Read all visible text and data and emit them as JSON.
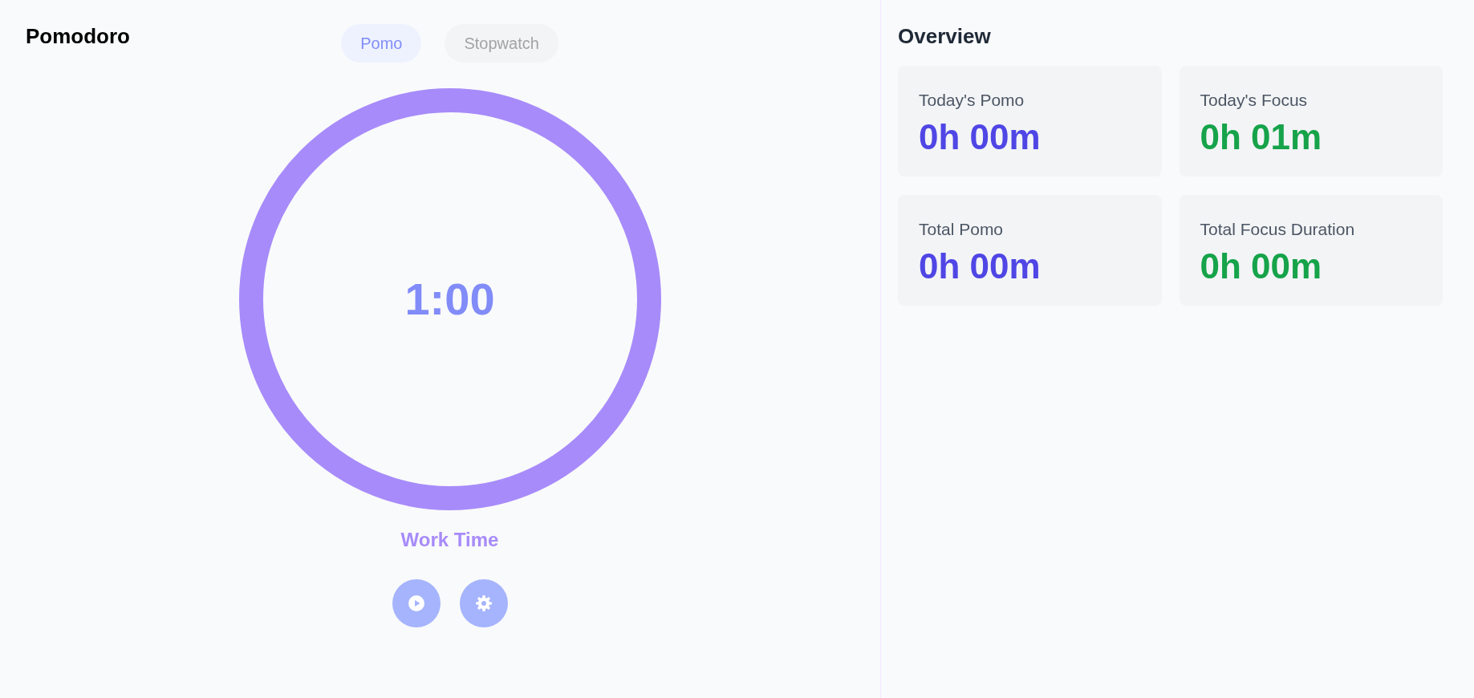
{
  "title": "Pomodoro",
  "tabs": [
    {
      "label": "Pomo",
      "selected": true
    },
    {
      "label": "Stopwatch",
      "selected": false
    }
  ],
  "timer": {
    "time": "1:00",
    "level": 1,
    "phase": "Work Time"
  },
  "controls": [
    {
      "kind": "play"
    },
    {
      "kind": "settings"
    }
  ],
  "overview": {
    "title": "Overview",
    "cards": [
      {
        "label": "Today's Pomo",
        "value": "0h 00m",
        "color": "#4f46e5"
      },
      {
        "label": "Today's Focus",
        "value": "0h 01m",
        "color": "#16a34a"
      },
      {
        "label": "Total Pomo",
        "value": "0h 00m",
        "color": "#4f46e5"
      },
      {
        "label": "Total Focus Duration",
        "value": "0h 00m",
        "color": "#16a34a"
      }
    ]
  }
}
